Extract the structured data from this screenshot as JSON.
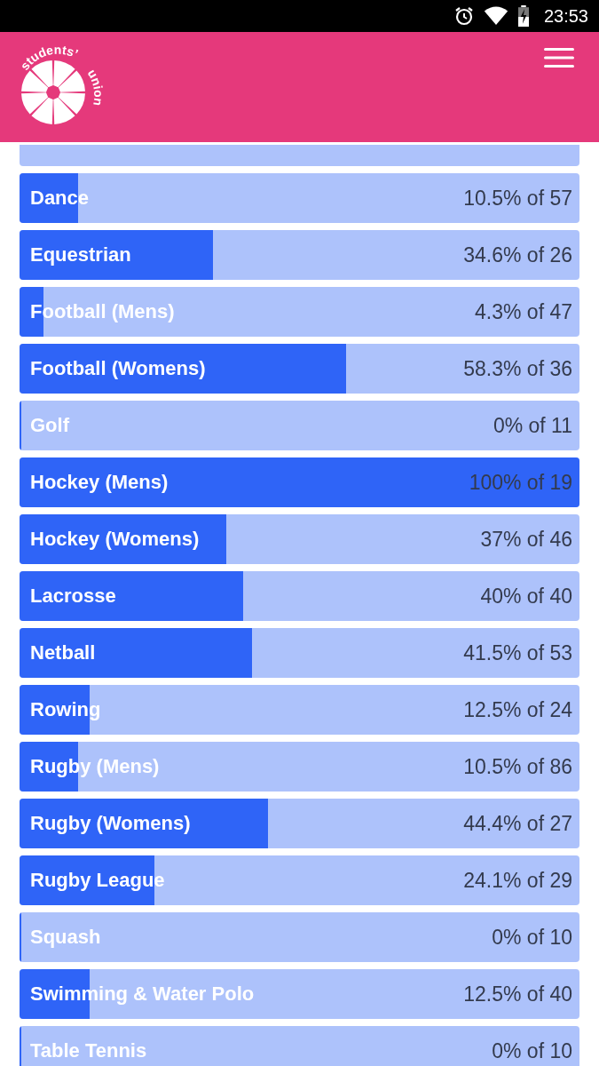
{
  "status_bar": {
    "time": "23:53"
  },
  "header": {
    "logo_words": [
      "students’",
      "union"
    ]
  },
  "rows": [
    {
      "kind": "cut"
    },
    {
      "kind": "bar",
      "label": "Dance",
      "reading": "10.5% of 57",
      "level": 0.105
    },
    {
      "kind": "bar",
      "label": "Equestrian",
      "reading": "34.6% of 26",
      "level": 0.346
    },
    {
      "kind": "bar",
      "label": "Football (Mens)",
      "reading": "4.3% of 47",
      "level": 0.043
    },
    {
      "kind": "bar",
      "label": "Football (Womens)",
      "reading": "58.3% of 36",
      "level": 0.583
    },
    {
      "kind": "bar",
      "label": "Golf",
      "reading": "0% of 11",
      "level": 0
    },
    {
      "kind": "bar",
      "label": "Hockey (Mens)",
      "reading": "100% of 19",
      "level": 1
    },
    {
      "kind": "bar",
      "label": "Hockey (Womens)",
      "reading": "37% of 46",
      "level": 0.37
    },
    {
      "kind": "bar",
      "label": "Lacrosse",
      "reading": "40% of 40",
      "level": 0.4
    },
    {
      "kind": "bar",
      "label": "Netball",
      "reading": "41.5% of 53",
      "level": 0.415
    },
    {
      "kind": "bar",
      "label": "Rowing",
      "reading": "12.5% of 24",
      "level": 0.125
    },
    {
      "kind": "bar",
      "label": "Rugby (Mens)",
      "reading": "10.5% of 86",
      "level": 0.105
    },
    {
      "kind": "bar",
      "label": "Rugby (Womens)",
      "reading": "44.4% of 27",
      "level": 0.444
    },
    {
      "kind": "bar",
      "label": "Rugby League",
      "reading": "24.1% of 29",
      "level": 0.241
    },
    {
      "kind": "bar",
      "label": "Squash",
      "reading": "0% of 10",
      "level": 0
    },
    {
      "kind": "bar",
      "label": "Swimming & Water Polo",
      "reading": "12.5% of 40",
      "level": 0.125
    },
    {
      "kind": "bar",
      "label": "Table Tennis",
      "reading": "0% of 10",
      "level": 0
    }
  ]
}
